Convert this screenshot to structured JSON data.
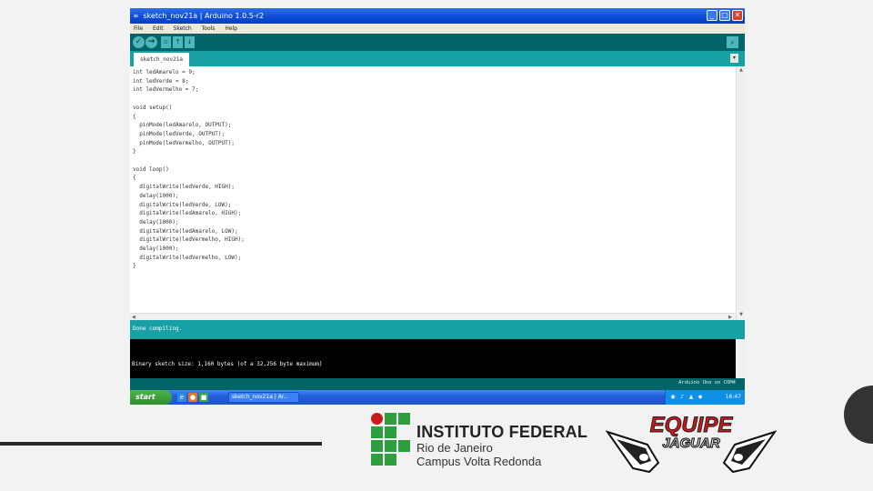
{
  "window": {
    "title_icon": "∞",
    "title": "sketch_nov21a | Arduino 1.0.5-r2",
    "minimize_glyph": "_",
    "maximize_glyph": "□",
    "close_glyph": "✕"
  },
  "menu": {
    "items": [
      "File",
      "Edit",
      "Sketch",
      "Tools",
      "Help"
    ]
  },
  "toolbar": {
    "verify_glyph": "✓",
    "upload_glyph": "→",
    "new_glyph": "▫",
    "open_glyph": "↑",
    "save_glyph": "↓",
    "serial_glyph": "⌕"
  },
  "tabs": {
    "active": "sketch_nov21a",
    "menu_glyph": "▾"
  },
  "editor": {
    "lines": [
      "int ledAmarelo = 9;",
      "int ledVerde = 8;",
      "int ledVermelho = 7;",
      "",
      "void setup()",
      "{",
      "  pinMode(ledAmarelo, OUTPUT);",
      "  pinMode(ledVerde, OUTPUT);",
      "  pinMode(ledVermelho, OUTPUT);",
      "}",
      "",
      "void loop()",
      "{",
      "  digitalWrite(ledVerde, HIGH);",
      "  delay(1000);",
      "  digitalWrite(ledVerde, LOW);",
      "  digitalWrite(ledAmarelo, HIGH);",
      "  delay(1000);",
      "  digitalWrite(ledAmarelo, LOW);",
      "  digitalWrite(ledVermelho, HIGH);",
      "  delay(1000);",
      "  digitalWrite(ledVermelho, LOW);",
      "}"
    ]
  },
  "status": {
    "message": "Done compiling."
  },
  "console": {
    "output": "Binary sketch size: 1,160 bytes (of a 32,256 byte maximum)"
  },
  "footer": {
    "board_info": "Arduino Uno on COM4"
  },
  "taskbar": {
    "start_label": "start",
    "task_label": "sketch_nov21a | Ar...",
    "clock": "16:47"
  },
  "logos": {
    "if_line1": "INSTITUTO FEDERAL",
    "if_line2": "Rio de Janeiro",
    "if_line3": "Campus Volta Redonda",
    "team_line1": "EQUIPE",
    "team_line2": "JAGUAR"
  },
  "colors": {
    "arduino_dark": "#006468",
    "arduino_teal": "#17a1a5",
    "if_green": "#2e9e3e",
    "if_red": "#c8191e",
    "jaguar_red": "#d1151b"
  }
}
